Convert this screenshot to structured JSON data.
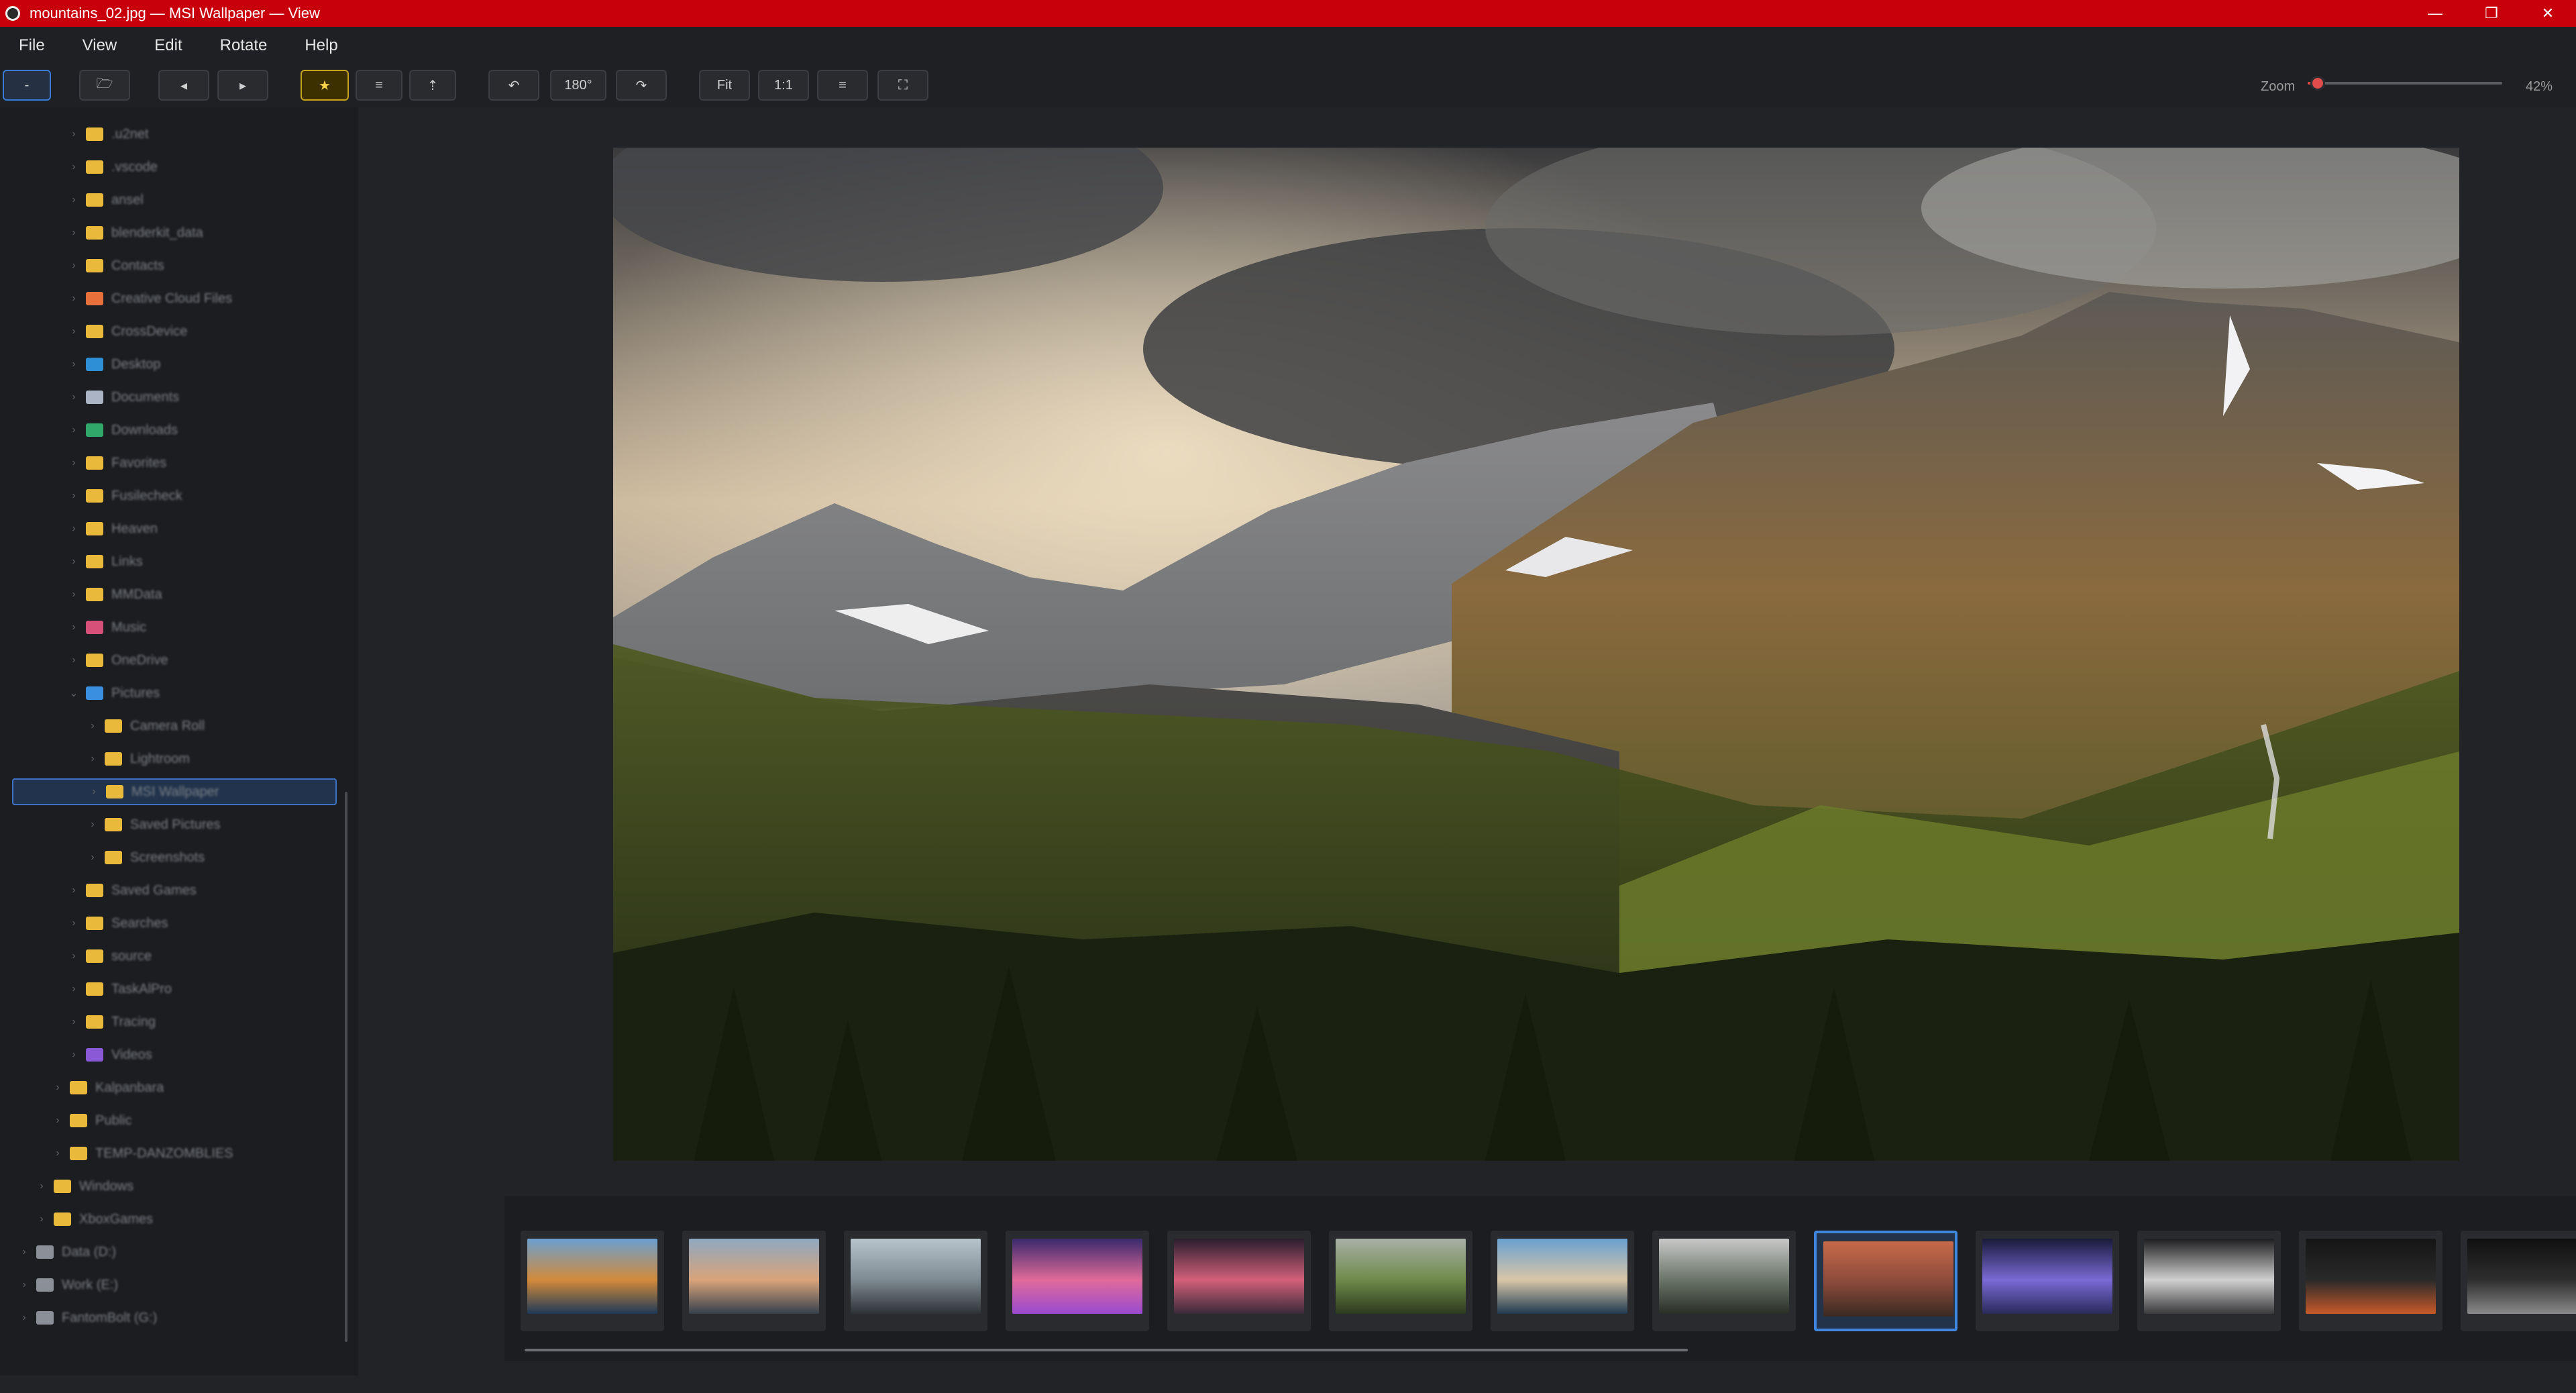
{
  "titlebar": {
    "title": "mountains_02.jpg — MSI Wallpaper — View",
    "minimize_icon": "minimize-icon",
    "restore_icon": "restore-icon",
    "close_icon": "close-icon",
    "minimize_glyph": "—",
    "restore_glyph": "❐",
    "close_glyph": "✕"
  },
  "menu": {
    "items": [
      {
        "label": "File"
      },
      {
        "label": "View"
      },
      {
        "label": "Edit"
      },
      {
        "label": "Rotate"
      },
      {
        "label": "Help"
      }
    ]
  },
  "toolbar": {
    "collapse_label": "-",
    "open_glyph": "🗁",
    "prev_glyph": "◂",
    "next_glyph": "▸",
    "favorite_glyph": "★",
    "info_glyph": "≡",
    "up_glyph": "⇡",
    "rotate_left_glyph": "↶",
    "rotate180_label": "180°",
    "rotate_right_glyph": "↷",
    "fit_label": "Fit",
    "actual_label": "1:1",
    "menu_glyph": "≡",
    "fullscreen_glyph": "⛶",
    "zoom_label": "Zoom",
    "zoom_value": "42%",
    "zoom_fraction": 0.05,
    "accent_color": "#e04b4b"
  },
  "sidebar": {
    "items": [
      {
        "label": ".u2net",
        "icon": "folder-icon",
        "color": "#e8b93a"
      },
      {
        "label": ".vscode",
        "icon": "folder-icon",
        "color": "#e8b93a"
      },
      {
        "label": "ansel",
        "icon": "folder-icon",
        "color": "#e8b93a"
      },
      {
        "label": "blenderkit_data",
        "icon": "folder-icon",
        "color": "#e8b93a"
      },
      {
        "label": "Contacts",
        "icon": "folder-icon",
        "color": "#e8b93a"
      },
      {
        "label": "Creative Cloud Files",
        "icon": "creative-cloud-icon",
        "color": "#e8703a"
      },
      {
        "label": "CrossDevice",
        "icon": "folder-icon",
        "color": "#e8b93a"
      },
      {
        "label": "Desktop",
        "icon": "desktop-icon",
        "color": "#2f8fd6"
      },
      {
        "label": "Documents",
        "icon": "documents-icon",
        "color": "#aab4c4"
      },
      {
        "label": "Downloads",
        "icon": "downloads-icon",
        "color": "#2fa86a"
      },
      {
        "label": "Favorites",
        "icon": "folder-icon",
        "color": "#e8b93a"
      },
      {
        "label": "Fusilecheck",
        "icon": "folder-icon",
        "color": "#e8b93a"
      },
      {
        "label": "Heaven",
        "icon": "folder-icon",
        "color": "#e8b93a"
      },
      {
        "label": "Links",
        "icon": "folder-icon",
        "color": "#e8b93a"
      },
      {
        "label": "MMData",
        "icon": "folder-icon",
        "color": "#e8b93a"
      },
      {
        "label": "Music",
        "icon": "music-icon",
        "color": "#d6507a"
      },
      {
        "label": "OneDrive",
        "icon": "folder-icon",
        "color": "#e8b93a"
      },
      {
        "label": "Pictures",
        "icon": "pictures-icon",
        "color": "#3a8fe0"
      },
      {
        "label": "Camera Roll",
        "icon": "folder-icon",
        "color": "#e8b93a"
      },
      {
        "label": "Lightroom",
        "icon": "folder-icon",
        "color": "#e8b93a"
      },
      {
        "label": "MSI Wallpaper",
        "icon": "folder-icon",
        "color": "#e8b93a"
      },
      {
        "label": "Saved Pictures",
        "icon": "folder-icon",
        "color": "#e8b93a"
      },
      {
        "label": "Screenshots",
        "icon": "folder-icon",
        "color": "#e8b93a"
      },
      {
        "label": "Saved Games",
        "icon": "folder-icon",
        "color": "#e8b93a"
      },
      {
        "label": "Searches",
        "icon": "folder-icon",
        "color": "#e8b93a"
      },
      {
        "label": "source",
        "icon": "folder-icon",
        "color": "#e8b93a"
      },
      {
        "label": "TaskAlPro",
        "icon": "folder-icon",
        "color": "#e8b93a"
      },
      {
        "label": "Tracing",
        "icon": "folder-icon",
        "color": "#e8b93a"
      },
      {
        "label": "Videos",
        "icon": "videos-icon",
        "color": "#8a5ad6"
      },
      {
        "label": "Kalpanbara",
        "icon": "folder-icon",
        "color": "#e8b93a"
      },
      {
        "label": "Public",
        "icon": "folder-icon",
        "color": "#e8b93a"
      },
      {
        "label": "TEMP-DANZOMBLIES",
        "icon": "folder-icon",
        "color": "#e8b93a"
      },
      {
        "label": "Windows",
        "icon": "folder-icon",
        "color": "#e8b93a"
      },
      {
        "label": "XboxGames",
        "icon": "folder-icon",
        "color": "#e8b93a"
      },
      {
        "label": "Data (D:)",
        "icon": "drive-icon",
        "color": "#8a8f98"
      },
      {
        "label": "Work (E:)",
        "icon": "drive-icon",
        "color": "#8a8f98"
      },
      {
        "label": "FantomBolt (G:)",
        "icon": "drive-icon",
        "color": "#8a8f98"
      }
    ]
  },
  "viewer": {
    "image_name": "mountains_02.jpg"
  },
  "filmstrip": {
    "thumbnails": [
      {
        "name": "lake-reflection"
      },
      {
        "name": "coastal-sunset"
      },
      {
        "name": "misty-coast"
      },
      {
        "name": "purple-lake"
      },
      {
        "name": "pink-horizon"
      },
      {
        "name": "foggy-forest"
      },
      {
        "name": "ocean-cliffs"
      },
      {
        "name": "misty-pines"
      },
      {
        "name": "mountains-02"
      },
      {
        "name": "msi-stage"
      },
      {
        "name": "msi-device"
      },
      {
        "name": "dark-pen"
      },
      {
        "name": "dark-device"
      }
    ],
    "active_index": 8
  }
}
